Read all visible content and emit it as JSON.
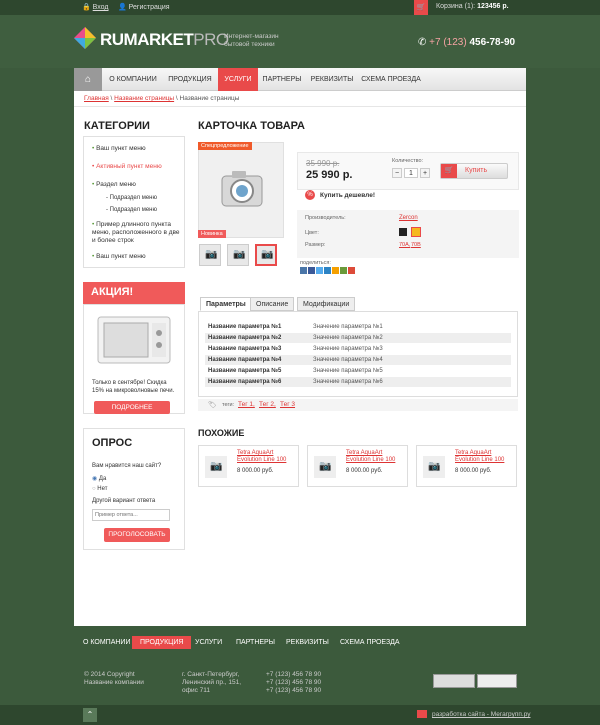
{
  "topbar": {
    "login": "Вход",
    "register": "Регистрация",
    "cart_label": "Корзина (1):",
    "cart_sum": "123456 р."
  },
  "header": {
    "logo_main": "RUMARKET",
    "logo_pro": "PRO",
    "tagline": "Интернет-магазин бытовой техники",
    "phone_prefix": "+7 (123)",
    "phone_number": "456-78-90"
  },
  "nav": {
    "items": [
      "О КОМПАНИИ",
      "ПРОДУКЦИЯ",
      "УСЛУГИ",
      "ПАРТНЕРЫ",
      "РЕКВИЗИТЫ",
      "СХЕМА ПРОЕЗДА"
    ]
  },
  "breadcrumb": {
    "home": "Главная",
    "section": "Название страницы",
    "current": "Название страницы"
  },
  "categories": {
    "title": "КАТЕГОРИИ",
    "items": [
      "Ваш пункт меню",
      "Активный пункт меню",
      "Раздел меню",
      "- Подраздел меню",
      "- Подраздел меню",
      "Пример длинного пункта меню, расположенного в две и более строк",
      "Ваш пункт меню"
    ]
  },
  "promo": {
    "title": "АКЦИЯ!",
    "text": "Только в сентябре! Скидка 15% на микроволновые печи.",
    "button": "ПОДРОБНЕЕ"
  },
  "poll": {
    "title": "ОПРОС",
    "question": "Вам нравится наш сайт?",
    "yes": "Да",
    "no": "Нет",
    "other": "Другой вариант ответа",
    "placeholder": "Пример ответа...",
    "button": "ПРОГОЛОСОВАТЬ"
  },
  "product": {
    "title": "КАРТОЧКА ТОВАРА",
    "badge_special": "Спецпредложение",
    "badge_new": "Новинка",
    "old_price": "35 990 р.",
    "price": "25 990 р.",
    "qty_label": "Количество:",
    "qty": "1",
    "buy": "Купить",
    "cheaper": "Купить дешевле!",
    "maker_label": "Производитель:",
    "maker": "Zercon",
    "color_label": "Цвет:",
    "size_label": "Размер:",
    "size1": "70А,",
    "size2": "70B",
    "share": "поделиться:"
  },
  "tabs": [
    "Параметры",
    "Описание",
    "Модификации"
  ],
  "params": [
    {
      "k": "Название параметра №1",
      "v": "Значение параметра №1"
    },
    {
      "k": "Название параметра №2",
      "v": "Значение параметра №2"
    },
    {
      "k": "Название параметра №3",
      "v": "Значение параметра №3"
    },
    {
      "k": "Название параметра №4",
      "v": "Значение параметра №4"
    },
    {
      "k": "Название параметра №5",
      "v": "Значение параметра №5"
    },
    {
      "k": "Название параметра №6",
      "v": "Значение параметра №6"
    }
  ],
  "tags": {
    "label": "теги:",
    "t1": "Тег 1,",
    "t2": "Тег 2,",
    "t3": "Тег 3"
  },
  "similar": {
    "title": "ПОХОЖИЕ",
    "item_title": "Tetra AquaArt Evolution Line 100",
    "item_price": "8 000.00 руб."
  },
  "footnav": {
    "items": [
      "О КОМПАНИИ",
      "ПРОДУКЦИЯ",
      "УСЛУГИ",
      "ПАРТНЕРЫ",
      "РЕКВИЗИТЫ",
      "СХЕМА ПРОЕЗДА"
    ]
  },
  "footer": {
    "copy1": "© 2014 Copyright",
    "copy2": "Название компании",
    "addr1": "г. Санкт-Петербург,",
    "addr2": "Ленинский пр., 151,",
    "addr3": "офис 711",
    "ph1": "+7 (123) 456 78 90",
    "ph2": "+7 (123) 456 78 90",
    "ph3": "+7 (123) 456 78 90",
    "dev": "разработка сайта - Мегагрупп.ру"
  },
  "colors": {
    "accent": "#e94a4a",
    "bg": "#3c5a3c"
  }
}
